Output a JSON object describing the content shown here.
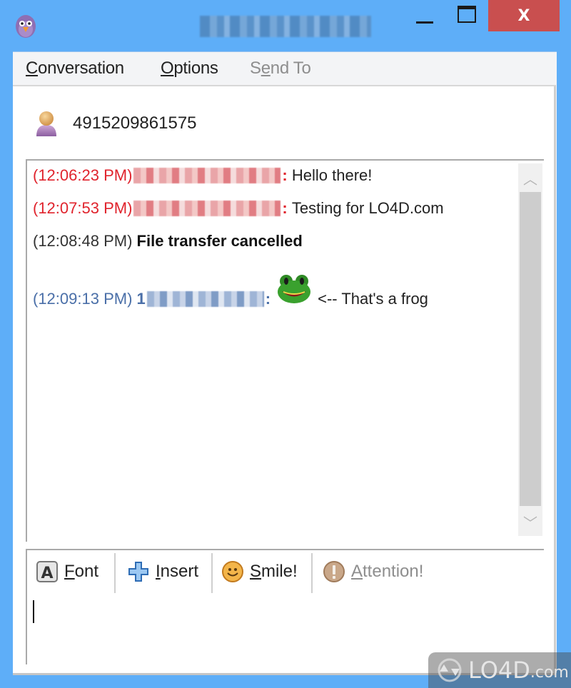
{
  "window": {
    "title": "4915209861575",
    "minimize_label": "Minimize",
    "maximize_label": "Maximize",
    "close_label": "X"
  },
  "menu": {
    "items": [
      {
        "label": "Conversation",
        "mnemonic": "C",
        "rest": "onversation",
        "enabled": true
      },
      {
        "label": "Options",
        "mnemonic": "O",
        "rest": "ptions",
        "enabled": true
      },
      {
        "label": "Send To",
        "pre": "S",
        "mnemonic": "e",
        "rest": "nd To",
        "enabled": false
      }
    ]
  },
  "buddy": {
    "name": "4915209861575",
    "icon": "user-icon"
  },
  "messages": [
    {
      "timestamp": "(12:06:23 PM)",
      "sender": "4915209861575",
      "sender_blurred": true,
      "text": "Hello there!",
      "color": "#e0242d",
      "type": "incoming"
    },
    {
      "timestamp": "(12:07:53 PM)",
      "sender": "4915209861575",
      "sender_blurred": true,
      "text": "Testing for LO4D.com",
      "color": "#e0242d",
      "type": "incoming"
    },
    {
      "timestamp": "(12:08:48 PM)",
      "text": "File transfer cancelled",
      "color": "#333333",
      "type": "system"
    },
    {
      "timestamp": "(12:09:13 PM)",
      "sender_prefix": "1",
      "sender_blurred": true,
      "emoticon": "frog-emoticon",
      "text": "<-- That's a frog",
      "color": "#4a6fa8",
      "type": "outgoing"
    }
  ],
  "scrollbar": {
    "up_glyph": "︿",
    "down_glyph": "﹀"
  },
  "toolbar": {
    "buttons": [
      {
        "label": "Font",
        "mnemonic": "F",
        "rest": "ont",
        "icon": "font-icon",
        "enabled": true
      },
      {
        "label": "Insert",
        "mnemonic": "I",
        "rest": "nsert",
        "icon": "plus-icon",
        "enabled": true
      },
      {
        "label": "Smile!",
        "mnemonic": "S",
        "rest": "mile!",
        "icon": "smiley-icon",
        "enabled": true
      },
      {
        "label": "Attention!",
        "mnemonic": "A",
        "rest": "ttention!",
        "icon": "attention-icon",
        "enabled": false
      }
    ]
  },
  "input": {
    "value": ""
  },
  "watermark": {
    "text": "LO4D",
    "suffix": ".com"
  },
  "colors": {
    "titlebar": "#5eaef8",
    "close_button": "#c94f4f",
    "incoming_timestamp": "#e0242d",
    "outgoing_timestamp": "#4a6fa8"
  }
}
